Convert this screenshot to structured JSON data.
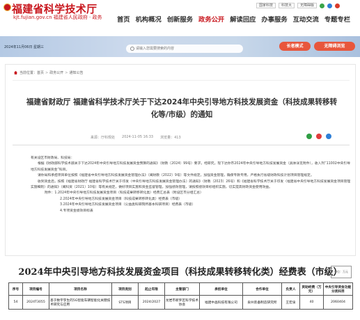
{
  "header": {
    "logo_title": "福建省科学技术厅",
    "logo_sub": "kjt.fujian.gov.cn 福建省人民政府 · 政务",
    "top_links": [
      "国家科技",
      "科技大",
      "无障碍版"
    ],
    "nav": [
      "首页",
      "机构概况",
      "创新服务",
      "政务公开",
      "解读回应",
      "办事服务",
      "互动交流",
      "专题专栏"
    ],
    "active_nav": "政务公开"
  },
  "banner": {
    "date": "2024年11月06日 星期三",
    "search_placeholder": "请输入您需要搜索的内容",
    "elder_mode": "长者模式",
    "accessible_mode": "无障碍浏览"
  },
  "breadcrumb": {
    "label": "当前位置：",
    "items": [
      "首页",
      "政务公开",
      "通知公告"
    ]
  },
  "article": {
    "title": "福建省财政厅 福建省科学技术厅关于下达2024年中央引导地方科技发展资金（科技成果转移转化等/市级）的通知",
    "date": "2024-11-05 16:33",
    "source": "来源：厅科规处",
    "views": "浏览量：413",
    "paragraphs": [
      "有关设区市财政局、科技局：",
      "根据《财政部科学技术部关于下达2024年中央引导地方科技发展资金预算的通知》（财教〔2024〕99号）要求，经研究，现下达你市2024年中央引导地方科技发展资金（具体详见附件），收入列“11002中央引导地方科技发展资金”科目。",
      "请你局和承担项目单位按照《福建省中央引导地方科技发展资金管理办法》（闽财教〔2022〕9号）等文件规定，加强资金管理，确保专款专用，严格执行省级财政科技计划项目管理规定。",
      "收到资金后，按照《福建省财政厅 福建省科学技术厅关于印发〈中央引导地方科技发展资金管理办法〉的通知》（财教〔2023〕26号）和《福建省科学技术厅关于印发〈福建省中央引导地方科技发展资金项目管理实施细则〉的通知》（闽科资〔2021〕10号）等有关规定，做好项目实施和资金监督管理，加强绩效管理，请按照绩效目标组织实施，切实提高财政资金使用效益。"
    ],
    "attachments_label": "附件：",
    "attachments": [
      "1.2024年中央引导地方科技发展资金项目（科技成果转移转化类）经费汇总表（附设区市分组汇总）",
      "2.2024年中央引导地方科技发展资金项目（科技成果转移转化类）经费表（市级）",
      "3.2024年中央引导地方科技发展资金项目（公益类科研院所基本科研项目）经费表（市级）",
      "4.专项资金绩效目标表"
    ]
  },
  "table": {
    "title": "2024年中央引导地方科技发展资金项目（科技成果转移转化类）经费表（市级）",
    "stamp": "单位：万元",
    "headers": [
      "序号",
      "项目编号",
      "项目名称",
      "项目类别",
      "起止年限",
      "主管部门",
      "承担单位",
      "合作单位",
      "负责人",
      "资助经费（万元）",
      "中央引导资金功能分类科目"
    ],
    "rows": [
      [
        "54",
        "2024T3055",
        "基于数字孪生的5G智能车辆智能化关键技术研究与应用",
        "STS项目",
        "2024/2027",
        "龙岩市新罗区科学技术协会",
        "福建中晶科技有限公司",
        "泉州装备制造研究所",
        "王宏泉",
        "40",
        "2060404"
      ]
    ]
  }
}
